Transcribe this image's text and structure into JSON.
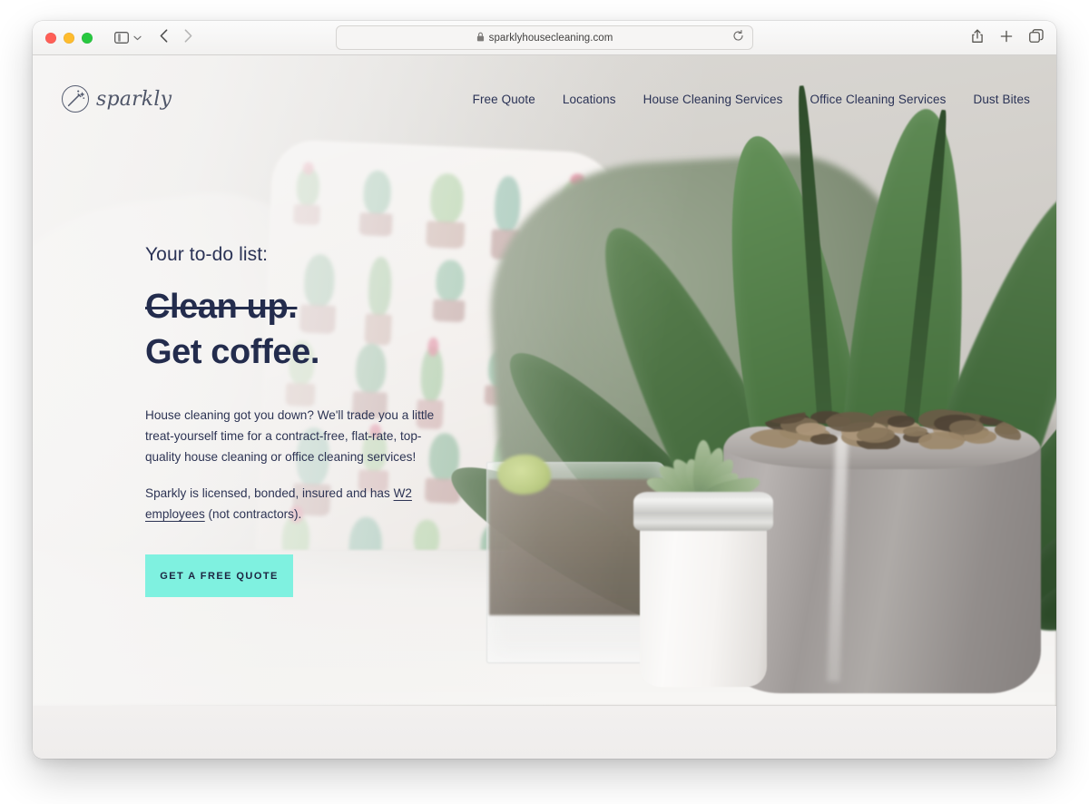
{
  "browser": {
    "window_controls": [
      "close",
      "minimize",
      "maximize"
    ],
    "sidebar_toggle_label": "Show sidebar",
    "back_label": "Back",
    "forward_label": "Forward",
    "url": "sparklyhousecleaning.com",
    "url_placeholder": "Search or enter website name",
    "lock_icon": "lock-icon",
    "reload_icon": "reload-icon",
    "share_icon": "share-icon",
    "new_tab_icon": "plus-icon",
    "tab_overview_icon": "tabs-icon"
  },
  "site": {
    "logo": {
      "icon": "magic-wand-icon",
      "wordmark": "sparkly"
    },
    "nav": [
      {
        "label": "Free Quote"
      },
      {
        "label": "Locations"
      },
      {
        "label": "House Cleaning Services"
      },
      {
        "label": "Office Cleaning Services"
      },
      {
        "label": "Dust Bites"
      }
    ],
    "hero": {
      "eyebrow": "Your to-do list:",
      "headline_struck": "Clean up.",
      "headline_main": "Get coffee.",
      "paragraph_1": "House cleaning got you down? We'll trade you a little treat-yourself time for a contract-free, flat-rate, top-quality house cleaning or office cleaning services!",
      "paragraph_2_before": "Sparkly is licensed, bonded, insured and has ",
      "paragraph_2_link": "W2 employees",
      "paragraph_2_after": " (not contractors).",
      "cta_label": "GET A FREE QUOTE"
    }
  },
  "colors": {
    "cta_background": "#7ff1e0",
    "cta_text": "#1c2440",
    "headline": "#232c4d",
    "nav_text": "#2b3356",
    "logo": "#4e5568",
    "body_text": "#2d3454"
  }
}
